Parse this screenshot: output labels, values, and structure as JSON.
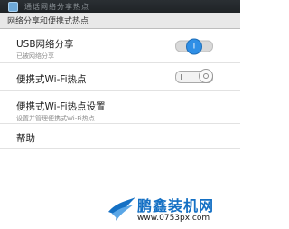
{
  "statusbar": {
    "title": "通话网络分享热点"
  },
  "section": {
    "title": "网络分享和便携式热点"
  },
  "rows": [
    {
      "label": "USB网络分享",
      "sub": "已被网络分享",
      "toggle": "on",
      "toggle_glyph": "I"
    },
    {
      "label": "便携式Wi-Fi热点",
      "toggle": "off"
    },
    {
      "label": "便携式Wi-Fi热点设置",
      "sub": "设置并管理便携式Wi-Fi热点"
    },
    {
      "label": "帮助"
    }
  ],
  "watermark": {
    "title": "鹏鑫装机网",
    "url": "www.0753px.com"
  },
  "colors": {
    "accent": "#2f8fe6",
    "statusbar": "#2a2f33",
    "watermark": "#1470c4"
  }
}
